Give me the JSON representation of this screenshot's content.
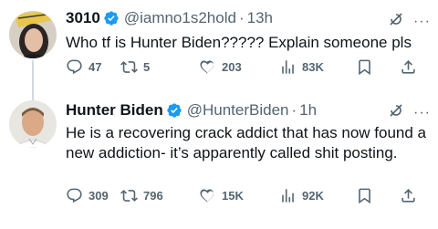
{
  "tweets": [
    {
      "name": "3010",
      "handle": "@iamno1s2hold",
      "separator": "·",
      "time": "13h",
      "text": "Who tf is Hunter Biden????? Explain someone pls",
      "replies": "47",
      "retweets": "5",
      "likes": "203",
      "views": "83K"
    },
    {
      "name": "Hunter Biden",
      "handle": "@HunterBiden",
      "separator": "·",
      "time": "1h",
      "text": "He is a recovering crack addict that has now found a new addiction- it’s apparently called shit posting.",
      "replies": "309",
      "retweets": "796",
      "likes": "15K",
      "views": "92K"
    }
  ],
  "colors": {
    "text": "#0f1419",
    "secondary": "#536471",
    "verified": "#1d9bf0",
    "thread_line": "#cfd9de"
  },
  "icons": [
    "verified-badge-icon",
    "grok-icon",
    "more-icon",
    "reply-icon",
    "retweet-icon",
    "like-icon",
    "views-icon",
    "bookmark-icon",
    "share-icon"
  ]
}
